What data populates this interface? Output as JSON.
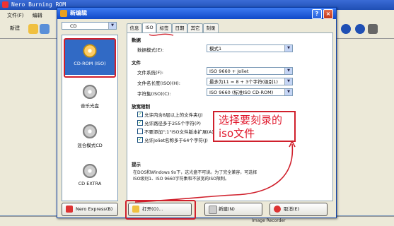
{
  "app": {
    "title": "Nero Burning ROM",
    "menu": [
      "文件(F)",
      "编辑"
    ],
    "toolbar_new": "新建",
    "bottom_status": "Image Recorder"
  },
  "dialog": {
    "title": "新编辑",
    "title_buttons": [
      "?",
      "×"
    ],
    "media_select": "CD",
    "left_items": [
      {
        "label": "CD-ROM (ISO)"
      },
      {
        "label": "音乐光盘"
      },
      {
        "label": "混合模式CD"
      },
      {
        "label": "CD EXTRA"
      }
    ],
    "tabs": [
      "信息",
      "ISO",
      "标签",
      "日期",
      "其它",
      "刻录"
    ],
    "sections": {
      "data": "数据",
      "file": "文件",
      "restrictions": "放宽限制",
      "hint": "提示"
    },
    "fields": {
      "data_mode_label": "数据模式(E):",
      "data_mode_value": "模式1",
      "file_system_label": "文件系统(F):",
      "file_system_value": "ISO 9660 + Joliet",
      "filename_length_label": "文件名长度(ISO)(H):",
      "filename_length_value": "最多为11 = 8 + 3个字符(级别1)",
      "charset_label": "字符集(ISO)(C):",
      "charset_value": "ISO 9660 (标准ISO CD-ROM)"
    },
    "checkboxes": [
      {
        "label": "允许内含8层以上的文件夹(J)",
        "checked": true
      },
      {
        "label": "允许路径多于255个字符(P)",
        "checked": true
      },
      {
        "label": "不要添加\";1\"ISO文件版本扩展(A)",
        "checked": false
      },
      {
        "label": "允许Joliet名称多于64个字符(J)",
        "checked": true
      }
    ],
    "hint_text": [
      "在DOS和Windows 9x下，这光盘不可读。为了完全兼容，可选择",
      "ISO级别1、ISO 9660字符集和不放宽的ISO限制。"
    ],
    "annotation": [
      "选择要刻录的",
      "iso文件"
    ],
    "buttons": {
      "nero_express": "Nero Express(B)",
      "open": "打开(O)...",
      "new": "新建(N)",
      "cancel": "取消(E)"
    }
  },
  "colors": {
    "accent_red": "#d0202c",
    "title_blue": "#0f49c8",
    "selection": "#316ac5"
  }
}
